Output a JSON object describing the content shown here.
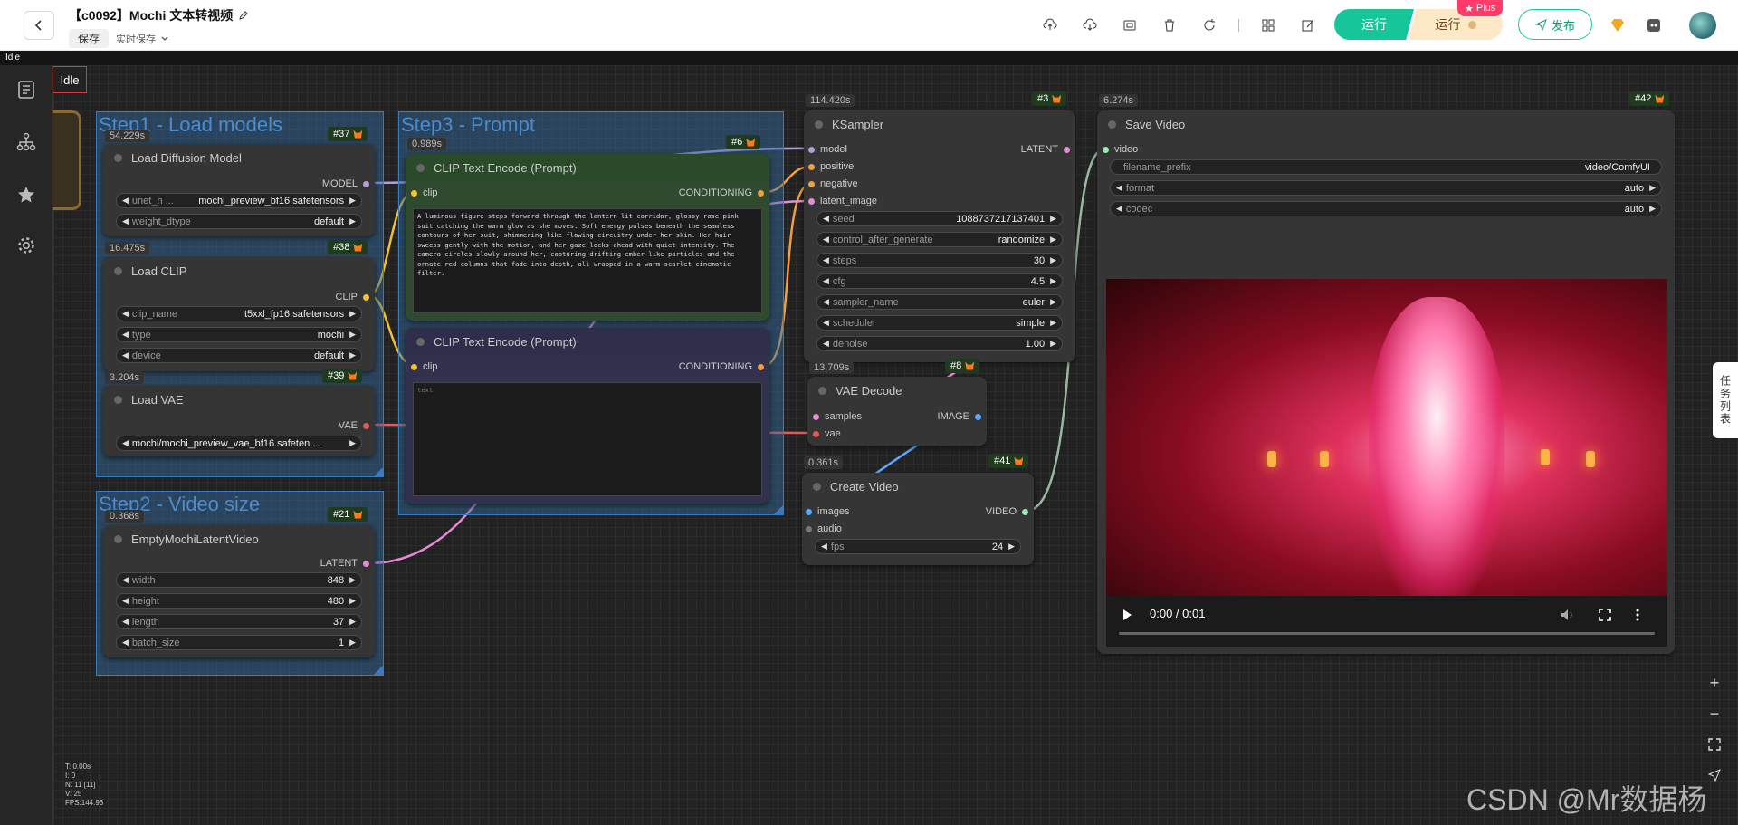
{
  "topbar": {
    "title": "【c0092】Mochi 文本转视频",
    "save_label": "保存",
    "autosave_label": "实时保存",
    "run_label": "运行",
    "run_plus_label": "运行",
    "plus_badge": "Plus",
    "publish_label": "发布"
  },
  "status": {
    "idle_strip": "Idle",
    "idle_label": "Idle"
  },
  "groups": {
    "step1": "Step1 - Load models",
    "step2": "Step2 - Video size",
    "step3": "Step3 - Prompt"
  },
  "nodes": {
    "load_diffusion": {
      "title": "Load Diffusion Model",
      "id": "#37",
      "time": "54.229s",
      "output": "MODEL",
      "widgets": [
        {
          "label": "unet_n ...",
          "value": "mochi_preview_bf16.safetensors"
        },
        {
          "label": "weight_dtype",
          "value": "default"
        }
      ]
    },
    "load_clip": {
      "title": "Load CLIP",
      "id": "#38",
      "time": "16.475s",
      "output": "CLIP",
      "widgets": [
        {
          "label": "clip_name",
          "value": "t5xxl_fp16.safetensors"
        },
        {
          "label": "type",
          "value": "mochi"
        },
        {
          "label": "device",
          "value": "default"
        }
      ]
    },
    "load_vae": {
      "title": "Load VAE",
      "id": "#39",
      "time": "3.204s",
      "output": "VAE",
      "widgets": [
        {
          "label": "mochi/mochi_preview_vae_bf16.safeten ...",
          "value": ""
        }
      ]
    },
    "latent": {
      "title": "EmptyMochiLatentVideo",
      "id": "#21",
      "time": "0.368s",
      "output": "LATENT",
      "widgets": [
        {
          "label": "width",
          "value": "848"
        },
        {
          "label": "height",
          "value": "480"
        },
        {
          "label": "length",
          "value": "37"
        },
        {
          "label": "batch_size",
          "value": "1"
        }
      ]
    },
    "clip_pos": {
      "title": "CLIP Text Encode (Prompt)",
      "id": "#6",
      "time": "0.989s",
      "input": "clip",
      "output": "CONDITIONING",
      "text": "A luminous figure steps forward through the lantern-lit corridor, glossy rose-pink suit catching the warm glow as she moves. Soft energy pulses beneath the seamless contours of her suit, shimmering like flowing circuitry under her skin. Her hair sweeps gently with the motion, and her gaze locks ahead with quiet intensity. The camera circles slowly around her, capturing drifting ember-like particles and the ornate red columns that fade into depth, all wrapped in a warm-scarlet cinematic filter."
    },
    "clip_neg": {
      "title": "CLIP Text Encode (Prompt)",
      "input": "clip",
      "output": "CONDITIONING",
      "placeholder": "text"
    },
    "ksampler": {
      "title": "KSampler",
      "id": "#3",
      "time": "114.420s",
      "inputs": [
        "model",
        "positive",
        "negative",
        "latent_image"
      ],
      "output": "LATENT",
      "widgets": [
        {
          "label": "seed",
          "value": "1088737217137401"
        },
        {
          "label": "control_after_generate",
          "value": "randomize"
        },
        {
          "label": "steps",
          "value": "30"
        },
        {
          "label": "cfg",
          "value": "4.5"
        },
        {
          "label": "sampler_name",
          "value": "euler"
        },
        {
          "label": "scheduler",
          "value": "simple"
        },
        {
          "label": "denoise",
          "value": "1.00"
        }
      ]
    },
    "vae_decode": {
      "title": "VAE Decode",
      "id": "#8",
      "time": "13.709s",
      "inputs": [
        "samples",
        "vae"
      ],
      "output": "IMAGE"
    },
    "create_video": {
      "title": "Create Video",
      "id": "#41",
      "time": "0.361s",
      "inputs": [
        "images",
        "audio"
      ],
      "output": "VIDEO",
      "widgets": [
        {
          "label": "fps",
          "value": "24"
        }
      ]
    },
    "save_video": {
      "title": "Save Video",
      "id": "#42",
      "time": "6.274s",
      "input": "video",
      "widgets": [
        {
          "label": "filename_prefix",
          "value": "video/ComfyUI"
        },
        {
          "label": "format",
          "value": "auto"
        },
        {
          "label": "codec",
          "value": "auto"
        }
      ],
      "player_time": "0:00 / 0:01"
    }
  },
  "task_tab": "任务列表",
  "stats": [
    "T: 0.00s",
    "I: 0",
    "N: 11 [11]",
    "V: 25",
    "FPS:144.93"
  ],
  "watermark": "CSDN @Mr数据杨"
}
